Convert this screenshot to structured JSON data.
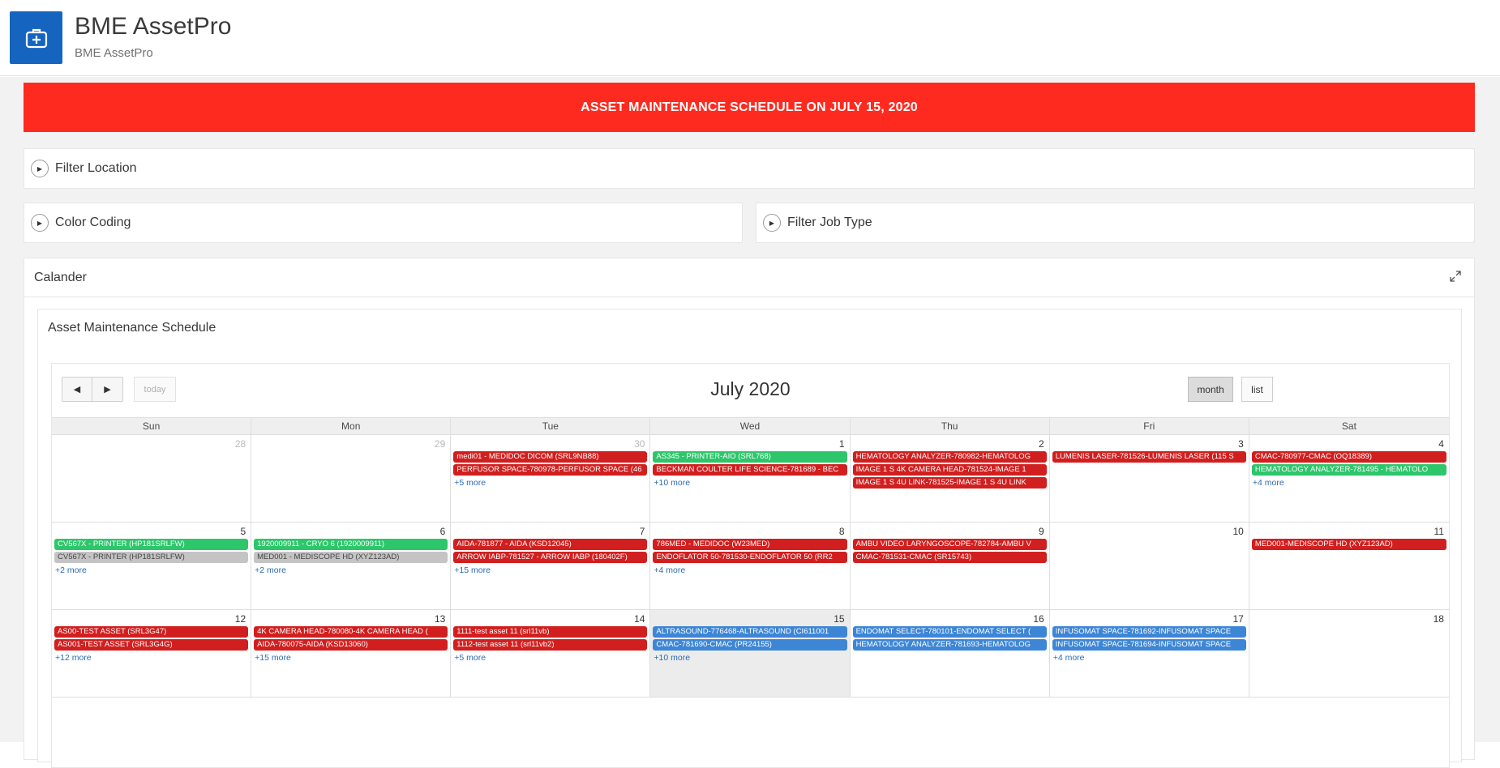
{
  "app": {
    "title": "BME AssetPro",
    "subtitle": "BME AssetPro",
    "logo_icon": "medical-kit-icon"
  },
  "banner": {
    "text": "ASSET MAINTENANCE SCHEDULE ON JULY 15, 2020",
    "color": "#ff2a1f"
  },
  "regions": {
    "filter_location": "Filter Location",
    "color_coding": "Color Coding",
    "filter_job_type": "Filter Job Type",
    "calendar_region": "Calander",
    "schedule_region": "Asset Maintenance Schedule"
  },
  "calendar": {
    "title": "July 2020",
    "today_label": "today",
    "month_label": "month",
    "list_label": "list",
    "days_of_week": [
      "Sun",
      "Mon",
      "Tue",
      "Wed",
      "Thu",
      "Fri",
      "Sat"
    ],
    "colors": {
      "red": "#d11f1f",
      "green": "#2dc66b",
      "blue": "#3d86d6",
      "gray": "#c4c4c4"
    },
    "weeks": [
      [
        {
          "num": "28",
          "other": true,
          "events": [],
          "more": ""
        },
        {
          "num": "29",
          "other": true,
          "events": [],
          "more": ""
        },
        {
          "num": "30",
          "other": true,
          "events": [
            {
              "text": "medi01 - MEDIDOC DICOM (SRL9NB88)",
              "color": "red"
            },
            {
              "text": "PERFUSOR SPACE-780978-PERFUSOR SPACE (46",
              "color": "red"
            }
          ],
          "more": "+5 more"
        },
        {
          "num": "1",
          "other": false,
          "events": [
            {
              "text": "AS345 - PRINTER-AIO (SRL768)",
              "color": "green"
            },
            {
              "text": "BECKMAN COULTER LIFE SCIENCE-781689 - BEC",
              "color": "red"
            }
          ],
          "more": "+10 more"
        },
        {
          "num": "2",
          "other": false,
          "events": [
            {
              "text": "HEMATOLOGY ANALYZER-780982-HEMATOLOG",
              "color": "red"
            },
            {
              "text": "IMAGE 1 S 4K CAMERA HEAD-781524-IMAGE 1",
              "color": "red"
            },
            {
              "text": "IMAGE 1 S 4U LINK-781525-IMAGE 1 S 4U LINK",
              "color": "red"
            }
          ],
          "more": ""
        },
        {
          "num": "3",
          "other": false,
          "events": [
            {
              "text": "LUMENIS LASER-781526-LUMENIS LASER (115 S",
              "color": "red"
            }
          ],
          "more": ""
        },
        {
          "num": "4",
          "other": false,
          "events": [
            {
              "text": "CMAC-780977-CMAC (OQ18389)",
              "color": "red"
            },
            {
              "text": "HEMATOLOGY ANALYZER-781495 - HEMATOLO",
              "color": "green"
            }
          ],
          "more": "+4 more"
        }
      ],
      [
        {
          "num": "5",
          "other": false,
          "events": [
            {
              "text": "CV567X - PRINTER (HP181SRLFW)",
              "color": "green"
            },
            {
              "text": "CV567X - PRINTER (HP181SRLFW)",
              "color": "gray"
            }
          ],
          "more": "+2 more"
        },
        {
          "num": "6",
          "other": false,
          "events": [
            {
              "text": "1920009911 - CRYO 6 (1920009911)",
              "color": "green"
            },
            {
              "text": "MED001 - MEDISCOPE HD (XYZ123AD)",
              "color": "gray"
            }
          ],
          "more": "+2 more"
        },
        {
          "num": "7",
          "other": false,
          "events": [
            {
              "text": "AIDA-781877 - AIDA (KSD12045)",
              "color": "red"
            },
            {
              "text": "ARROW IABP-781527 - ARROW IABP (180402F)",
              "color": "red"
            }
          ],
          "more": "+15 more"
        },
        {
          "num": "8",
          "other": false,
          "events": [
            {
              "text": "786MED - MEDIDOC (W23MED)",
              "color": "red"
            },
            {
              "text": "ENDOFLATOR 50-781530-ENDOFLATOR 50 (RR2",
              "color": "red"
            }
          ],
          "more": "+4 more"
        },
        {
          "num": "9",
          "other": false,
          "events": [
            {
              "text": "AMBU VIDEO LARYNGOSCOPE-782784-AMBU V",
              "color": "red"
            },
            {
              "text": "CMAC-781531-CMAC (SR15743)",
              "color": "red"
            }
          ],
          "more": ""
        },
        {
          "num": "10",
          "other": false,
          "events": [],
          "more": ""
        },
        {
          "num": "11",
          "other": false,
          "events": [
            {
              "text": "MED001-MEDISCOPE HD (XYZ123AD)",
              "color": "red"
            }
          ],
          "more": ""
        }
      ],
      [
        {
          "num": "12",
          "other": false,
          "events": [
            {
              "text": "AS00-TEST ASSET (SRL3G47)",
              "color": "red"
            },
            {
              "text": "AS001-TEST ASSET (SRL3G4G)",
              "color": "red"
            }
          ],
          "more": "+12 more"
        },
        {
          "num": "13",
          "other": false,
          "events": [
            {
              "text": "4K CAMERA HEAD-780080-4K CAMERA HEAD (",
              "color": "red"
            },
            {
              "text": "AIDA-780075-AIDA (KSD13060)",
              "color": "red"
            }
          ],
          "more": "+15 more"
        },
        {
          "num": "14",
          "other": false,
          "events": [
            {
              "text": "1111-test asset 11 (srl11vb)",
              "color": "red"
            },
            {
              "text": "1112-test asset 11 (srl11vb2)",
              "color": "red"
            }
          ],
          "more": "+5 more"
        },
        {
          "num": "15",
          "other": false,
          "today": true,
          "events": [
            {
              "text": "ALTRASOUND-776468-ALTRASOUND (CI611001",
              "color": "blue"
            },
            {
              "text": "CMAC-781690-CMAC (PR24155)",
              "color": "blue"
            }
          ],
          "more": "+10 more"
        },
        {
          "num": "16",
          "other": false,
          "events": [
            {
              "text": "ENDOMAT SELECT-780101-ENDOMAT SELECT (",
              "color": "blue"
            },
            {
              "text": "HEMATOLOGY ANALYZER-781693-HEMATOLOG",
              "color": "blue"
            }
          ],
          "more": ""
        },
        {
          "num": "17",
          "other": false,
          "events": [
            {
              "text": "INFUSOMAT SPACE-781692-INFUSOMAT SPACE",
              "color": "blue"
            },
            {
              "text": "INFUSOMAT SPACE-781694-INFUSOMAT SPACE",
              "color": "blue"
            }
          ],
          "more": "+4 more"
        },
        {
          "num": "18",
          "other": false,
          "events": [],
          "more": ""
        }
      ]
    ]
  }
}
